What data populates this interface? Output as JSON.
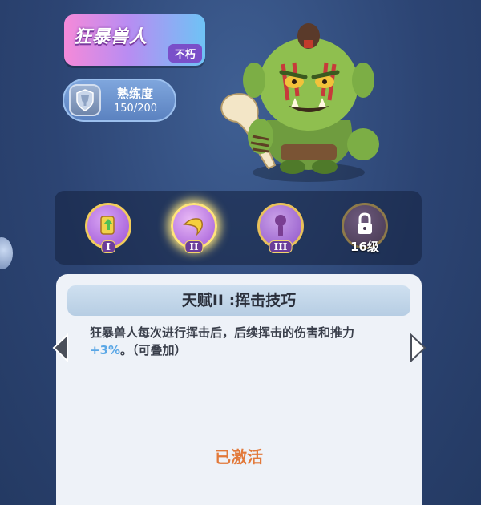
{
  "hero": {
    "name": "狂暴兽人",
    "tag": "不朽"
  },
  "proficiency": {
    "label": "熟练度",
    "value": "150/200",
    "icon": "trophy-shield-icon"
  },
  "talents": [
    {
      "numeral": "I",
      "state": "unlocked",
      "icon": "flag-upgrade-icon"
    },
    {
      "numeral": "II",
      "state": "selected",
      "icon": "swing-arc-icon"
    },
    {
      "numeral": "III",
      "state": "unlocked",
      "icon": "figure-icon"
    },
    {
      "level_label": "16级",
      "state": "locked",
      "icon": "lock-icon"
    }
  ],
  "talent_card": {
    "title": "天赋II :挥击技巧",
    "desc_prefix": "狂暴兽人每次进行挥击后，后续挥击的伤害和推力",
    "desc_highlight": "+3%",
    "desc_suffix": "。（可叠加）",
    "status": "已激活"
  },
  "colors": {
    "highlight": "#5aa7e6",
    "status": "#e2793a"
  }
}
